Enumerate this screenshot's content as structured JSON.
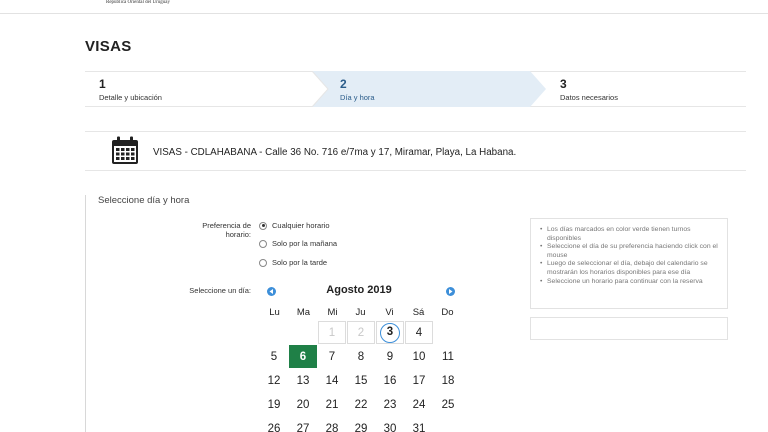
{
  "header": {
    "org_name": "República Oriental del Uruguay",
    "page_title": "VISAS"
  },
  "steps": [
    {
      "number": "1",
      "label": "Detalle y ubicación"
    },
    {
      "number": "2",
      "label": "Día y hora"
    },
    {
      "number": "3",
      "label": "Datos necesarios"
    }
  ],
  "location": {
    "text": "VISAS - CDLAHABANA - Calle 36 No. 716 e/7ma y 17, Miramar, Playa, La Habana.",
    "icon": "calendar-icon"
  },
  "section": {
    "title": "Seleccione día y hora",
    "preference_label": "Preferencia de horario:",
    "options": [
      {
        "label": "Cualquier horario",
        "checked": true
      },
      {
        "label": "Solo por la mañana",
        "checked": false
      },
      {
        "label": "Solo por la tarde",
        "checked": false
      }
    ],
    "day_label": "Seleccione un día:"
  },
  "calendar": {
    "month": "Agosto 2019",
    "prev_icon": "chevron-left-icon",
    "next_icon": "chevron-right-icon",
    "weekdays": [
      "Lu",
      "Ma",
      "Mi",
      "Ju",
      "Vi",
      "Sá",
      "Do"
    ],
    "weeks": [
      [
        "",
        "",
        "1",
        "2",
        "3",
        "4",
        ""
      ],
      [
        "5",
        "6",
        "7",
        "8",
        "9",
        "10",
        "11"
      ],
      [
        "12",
        "13",
        "14",
        "15",
        "16",
        "17",
        "18"
      ],
      [
        "19",
        "20",
        "21",
        "22",
        "23",
        "24",
        "25"
      ],
      [
        "26",
        "27",
        "28",
        "29",
        "30",
        "31",
        ""
      ]
    ],
    "disabled_days": [
      "1",
      "2"
    ],
    "today": "3",
    "selected": "6"
  },
  "info": {
    "items": [
      "Los días marcados en color verde tienen turnos disponibles",
      "Seleccione el día de su preferencia haciendo click con el mouse",
      "Luego de seleccionar el día, debajo del calendario se mostrarán los horarios disponibles para ese día",
      "Seleccione un horario para continuar con la reserva"
    ]
  },
  "colors": {
    "accent_blue": "#3d8fd9",
    "available_green": "#1f8047",
    "active_step_bg": "#e3edf6"
  }
}
